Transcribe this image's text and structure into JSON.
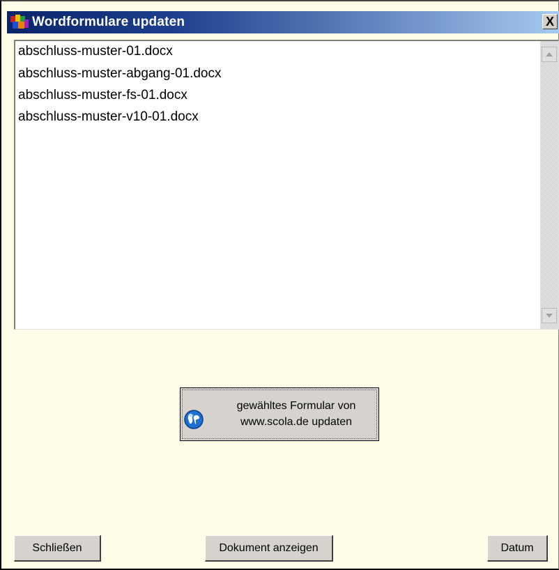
{
  "window": {
    "title": "Wordformulare updaten",
    "close_label": "X"
  },
  "files": [
    "abschluss-muster-01.docx",
    "abschluss-muster-abgang-01.docx",
    "abschluss-muster-fs-01.docx",
    "abschluss-muster-v10-01.docx"
  ],
  "update_button": {
    "line1": "gewähltes Formular von",
    "line2": "www.scola.de updaten",
    "icon": "globe-icon"
  },
  "buttons": {
    "close": "Schließen",
    "show_document": "Dokument anzeigen",
    "date": "Datum"
  },
  "colors": {
    "titlebar_start": "#0a246a",
    "titlebar_end": "#a6caf0",
    "background": "#fffde7",
    "button_face": "#d6d3ce"
  }
}
